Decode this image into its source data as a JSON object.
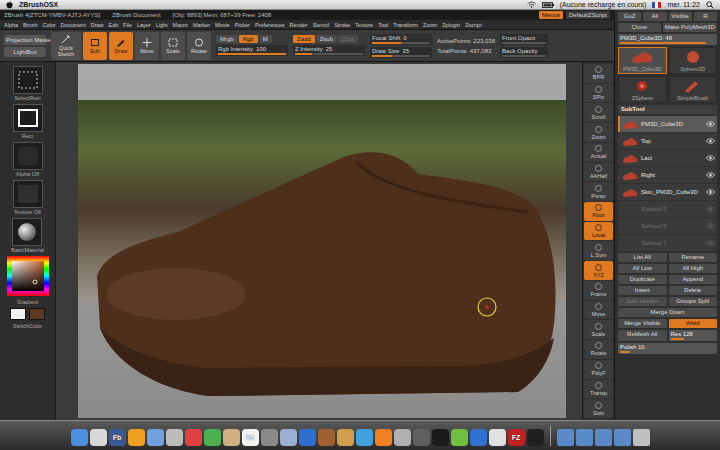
{
  "mac_menubar": {
    "app": "ZBrushOSX",
    "battery_status": "(Aucune recharge en cours)",
    "clock": "mer. 11:22"
  },
  "titlebar": {
    "title": "ZBrush 4[ZTCM-YMBV-AJTJ-AYYS]",
    "document": "ZBrush Document",
    "info": "[Obj: 8893] Mem: 687+39 Free: 2408",
    "buttons": [
      {
        "label": "Menus",
        "selected": true
      },
      {
        "label": "DefaultZScript",
        "selected": false
      }
    ]
  },
  "menus": [
    "Alpha",
    "Brush",
    "Color",
    "Document",
    "Draw",
    "Edit",
    "File",
    "Layer",
    "Light",
    "Macro",
    "Marker",
    "Movie",
    "Picker",
    "Preferences",
    "Render",
    "Stencil",
    "Stroke",
    "Texture",
    "Tool",
    "Transform",
    "Zoom",
    "Zplugin",
    "Zscript"
  ],
  "toolbar": {
    "panels": [
      "Projection Master",
      "LightBox"
    ],
    "modes": [
      {
        "label": "Quick Sketch",
        "selected": false
      },
      {
        "label": "Edit",
        "selected": true
      },
      {
        "label": "Draw",
        "selected": true
      },
      {
        "label": "Move",
        "selected": false
      },
      {
        "label": "Scale",
        "selected": false
      },
      {
        "label": "Rotate",
        "selected": false
      }
    ],
    "color_group": {
      "toggles": [
        {
          "label": "Mrgb",
          "selected": false,
          "disabled": false
        },
        {
          "label": "Rgb",
          "selected": true,
          "disabled": false
        },
        {
          "label": "M",
          "selected": false,
          "disabled": false
        }
      ],
      "slider": {
        "label": "Rgb Intensity",
        "value": "100",
        "level": 1
      }
    },
    "z_group": {
      "toggles": [
        {
          "label": "Zadd",
          "selected": true,
          "disabled": false
        },
        {
          "label": "Zsub",
          "selected": false,
          "disabled": false
        },
        {
          "label": "Zcut",
          "selected": false,
          "disabled": true
        }
      ],
      "slider": {
        "label": "Z Intensity",
        "value": "25",
        "level": 0.25
      }
    },
    "brush_sliders": [
      {
        "label": "Focal Shift",
        "value": "0",
        "level": 0.5
      },
      {
        "label": "Draw Size",
        "value": "35",
        "level": 0.35
      }
    ],
    "stats": [
      "ActivePoints: 223,038",
      "TotalPoints: 437,083"
    ],
    "opacity": [
      {
        "label": "Front Opacit",
        "level": 0
      },
      {
        "label": "Back Opacity",
        "level": 0
      }
    ]
  },
  "left_panel": {
    "items": [
      {
        "label": "SelectRect",
        "kind": "stroke"
      },
      {
        "label": "Rect",
        "kind": "rect"
      },
      {
        "label": "Alpha Off",
        "kind": "alpha"
      },
      {
        "label": "Texture Off",
        "kind": "texture"
      },
      {
        "label": "BasicMaterial",
        "kind": "material"
      }
    ],
    "gradient": "Gradient",
    "colors": [
      {
        "color": "#f2f2f2"
      },
      {
        "color": "#5c3a22"
      }
    ],
    "switch_color": "SwitchColor"
  },
  "shelf": [
    {
      "label": "BPR",
      "selected": false
    },
    {
      "label": "SPix",
      "selected": false
    },
    {
      "label": "Scroll",
      "selected": false
    },
    {
      "label": "Zoom",
      "selected": false
    },
    {
      "label": "Actual",
      "selected": false
    },
    {
      "label": "AAHalf",
      "selected": false
    },
    {
      "label": "Persp",
      "selected": false
    },
    {
      "label": "Floor",
      "selected": true
    },
    {
      "label": "Local",
      "selected": true
    },
    {
      "label": "L.Sym",
      "selected": false
    },
    {
      "label": "XYZ",
      "selected": true
    },
    {
      "label": "Frame",
      "selected": false
    },
    {
      "label": "Move",
      "selected": false
    },
    {
      "label": "Scale",
      "selected": false
    },
    {
      "label": "Rotate",
      "selected": false
    },
    {
      "label": "PolyF",
      "selected": false
    },
    {
      "label": "Transp",
      "selected": false
    },
    {
      "label": "Solo",
      "selected": false
    }
  ],
  "tool_palette": {
    "header": [
      "GoZ",
      "All",
      "Visible",
      "R"
    ],
    "actions": [
      "Clone",
      "Make PolyMesh3D"
    ],
    "current": {
      "label": "PM3D_Cube3D: 48",
      "level": 0.9
    },
    "tools": [
      {
        "label": "PM3D_Cube3D",
        "kind": "shoe",
        "selected": true
      },
      {
        "label": "Sphere3D",
        "kind": "sphere",
        "selected": false
      },
      {
        "label": "ZSphere",
        "kind": "zsphere",
        "selected": false
      },
      {
        "label": "SimpleBrush",
        "kind": "brush",
        "selected": false
      }
    ],
    "subtool": {
      "title": "SubTool",
      "items": [
        {
          "name": "PM3D_Cube3D",
          "selected": true,
          "visible": true,
          "empty": false
        },
        {
          "name": "Top",
          "selected": false,
          "visible": true,
          "empty": false
        },
        {
          "name": "Laci",
          "selected": false,
          "visible": true,
          "empty": false
        },
        {
          "name": "Right",
          "selected": false,
          "visible": true,
          "empty": false
        },
        {
          "name": "Skin_PM3D_Cube3D",
          "selected": false,
          "visible": true,
          "empty": false
        },
        {
          "name": "Subtool 5",
          "selected": false,
          "visible": false,
          "empty": true
        },
        {
          "name": "Subtool 6",
          "selected": false,
          "visible": false,
          "empty": true
        },
        {
          "name": "Subtool 7",
          "selected": false,
          "visible": false,
          "empty": true
        }
      ],
      "buttons": [
        [
          {
            "label": "List All",
            "kind": "button",
            "selected": false,
            "disabled": false
          },
          {
            "label": "Rename",
            "kind": "button",
            "selected": false,
            "disabled": false
          }
        ],
        [
          {
            "label": "All Low",
            "kind": "button",
            "selected": false,
            "disabled": false
          },
          {
            "label": "All High",
            "kind": "button",
            "selected": false,
            "disabled": false
          }
        ],
        [
          {
            "label": "Duplicate",
            "kind": "button",
            "selected": false,
            "disabled": false
          },
          {
            "label": "Append",
            "kind": "button",
            "selected": false,
            "disabled": false
          }
        ],
        [
          {
            "label": "Insert",
            "kind": "button",
            "selected": false,
            "disabled": false
          },
          {
            "label": "Delete",
            "kind": "button",
            "selected": false,
            "disabled": false
          }
        ],
        [
          {
            "label": "Split Hidden",
            "kind": "button",
            "selected": false,
            "disabled": true
          },
          {
            "label": "Groups Split",
            "kind": "button",
            "selected": false,
            "disabled": false
          }
        ],
        [
          {
            "label": "Merge Down",
            "kind": "button",
            "selected": false,
            "disabled": false
          }
        ],
        [
          {
            "label": "Merge Visible",
            "kind": "button",
            "selected": false,
            "disabled": false
          },
          {
            "label": "Weld",
            "kind": "button",
            "selected": true,
            "disabled": false
          }
        ],
        [
          {
            "label": "ReMesh All",
            "kind": "button",
            "selected": false,
            "disabled": false
          },
          {
            "label": "Res 128",
            "kind": "slider",
            "selected": false,
            "disabled": false,
            "level": 0.3
          }
        ],
        [
          {
            "label": "Polish 10",
            "kind": "slider",
            "selected": false,
            "disabled": false,
            "level": 0.1
          }
        ]
      ]
    }
  },
  "dock": [
    {
      "kind": "app",
      "color": "#4a8fe0"
    },
    {
      "kind": "app",
      "color": "#d8d8d8"
    },
    {
      "kind": "app",
      "color": "#3b5998",
      "label": "Fb"
    },
    {
      "kind": "app",
      "color": "#f0a020"
    },
    {
      "kind": "app",
      "color": "#6fa0e0"
    },
    {
      "kind": "app",
      "color": "#bcbcbc"
    },
    {
      "kind": "app",
      "color": "#e04040"
    },
    {
      "kind": "app",
      "color": "#4caf50"
    },
    {
      "kind": "app",
      "color": "#d0b080"
    },
    {
      "kind": "app",
      "color": "#f4f4f4",
      "label": "25"
    },
    {
      "kind": "app",
      "color": "#8a8a8a"
    },
    {
      "kind": "app",
      "color": "#9ab0d0"
    },
    {
      "kind": "app",
      "color": "#2d6fd0"
    },
    {
      "kind": "app",
      "color": "#a06030"
    },
    {
      "kind": "app",
      "color": "#d0a050"
    },
    {
      "kind": "app",
      "color": "#40a0e0"
    },
    {
      "kind": "app",
      "color": "#f08020"
    },
    {
      "kind": "app",
      "color": "#b0b0b0"
    },
    {
      "kind": "app",
      "color": "#606060"
    },
    {
      "kind": "app",
      "color": "#1a1a1a"
    },
    {
      "kind": "app",
      "color": "#70c040"
    },
    {
      "kind": "app",
      "color": "#3070d0"
    },
    {
      "kind": "app",
      "color": "#e0e0e0"
    },
    {
      "kind": "app",
      "color": "#c02020",
      "label": "FZ"
    },
    {
      "kind": "app",
      "color": "#202020"
    },
    {
      "kind": "folder",
      "color": "#5a8ac8"
    },
    {
      "kind": "folder",
      "color": "#5a8ac8"
    },
    {
      "kind": "folder",
      "color": "#5a8ac8"
    },
    {
      "kind": "folder",
      "color": "#5a8ac8"
    },
    {
      "kind": "folder",
      "color": "#c0c0c0"
    }
  ]
}
